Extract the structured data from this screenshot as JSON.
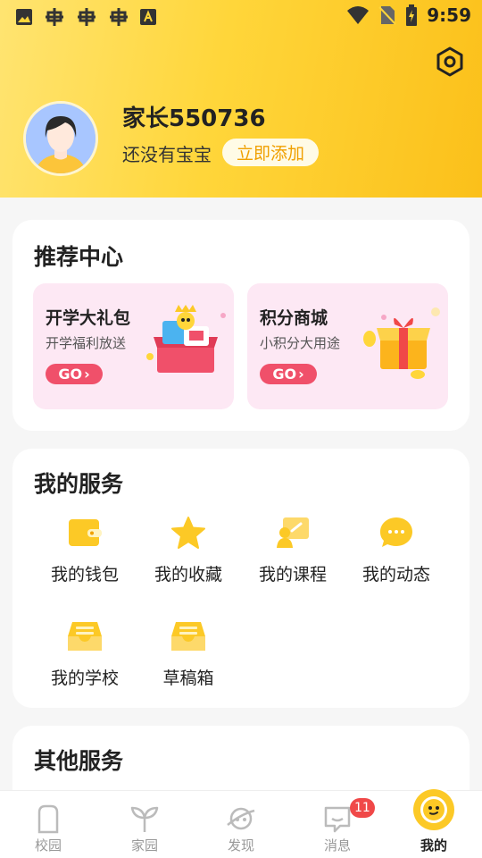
{
  "status_bar": {
    "time": "9:59",
    "left_icons": [
      "image-icon",
      "bug-icon",
      "bug-icon",
      "bug-icon",
      "font-icon"
    ],
    "right_icons": [
      "wifi-icon",
      "no-sim-icon",
      "battery-charging-icon"
    ]
  },
  "profile": {
    "username": "家长550736",
    "baby_status": "还没有宝宝",
    "add_label": "立即添加",
    "avatar_icon": "avatar-icon",
    "settings_icon": "settings-icon"
  },
  "recommend": {
    "title": "推荐中心",
    "items": [
      {
        "title": "开学大礼包",
        "subtitle": "开学福利放送",
        "go_label": "GO",
        "icon": "gift-box-icon"
      },
      {
        "title": "积分商城",
        "subtitle": "小积分大用途",
        "go_label": "GO",
        "icon": "gift-coins-icon"
      }
    ]
  },
  "services": {
    "title": "我的服务",
    "items": [
      {
        "label": "我的钱包",
        "icon": "wallet-icon"
      },
      {
        "label": "我的收藏",
        "icon": "star-icon"
      },
      {
        "label": "我的课程",
        "icon": "course-icon"
      },
      {
        "label": "我的动态",
        "icon": "chat-bubble-icon"
      },
      {
        "label": "我的学校",
        "icon": "inbox-icon"
      },
      {
        "label": "草稿箱",
        "icon": "drafts-icon"
      }
    ]
  },
  "other": {
    "title": "其他服务"
  },
  "tabbar": {
    "tabs": [
      {
        "label": "校园",
        "icon": "campus-icon"
      },
      {
        "label": "家园",
        "icon": "sprout-icon"
      },
      {
        "label": "发现",
        "icon": "planet-icon"
      },
      {
        "label": "消息",
        "icon": "message-icon"
      },
      {
        "label": "我的",
        "icon": "me-icon"
      }
    ],
    "message_badge": "11",
    "active": "我的"
  },
  "colors": {
    "accent": "#fcc926",
    "go": "#f0506a",
    "badge": "#f04848"
  }
}
